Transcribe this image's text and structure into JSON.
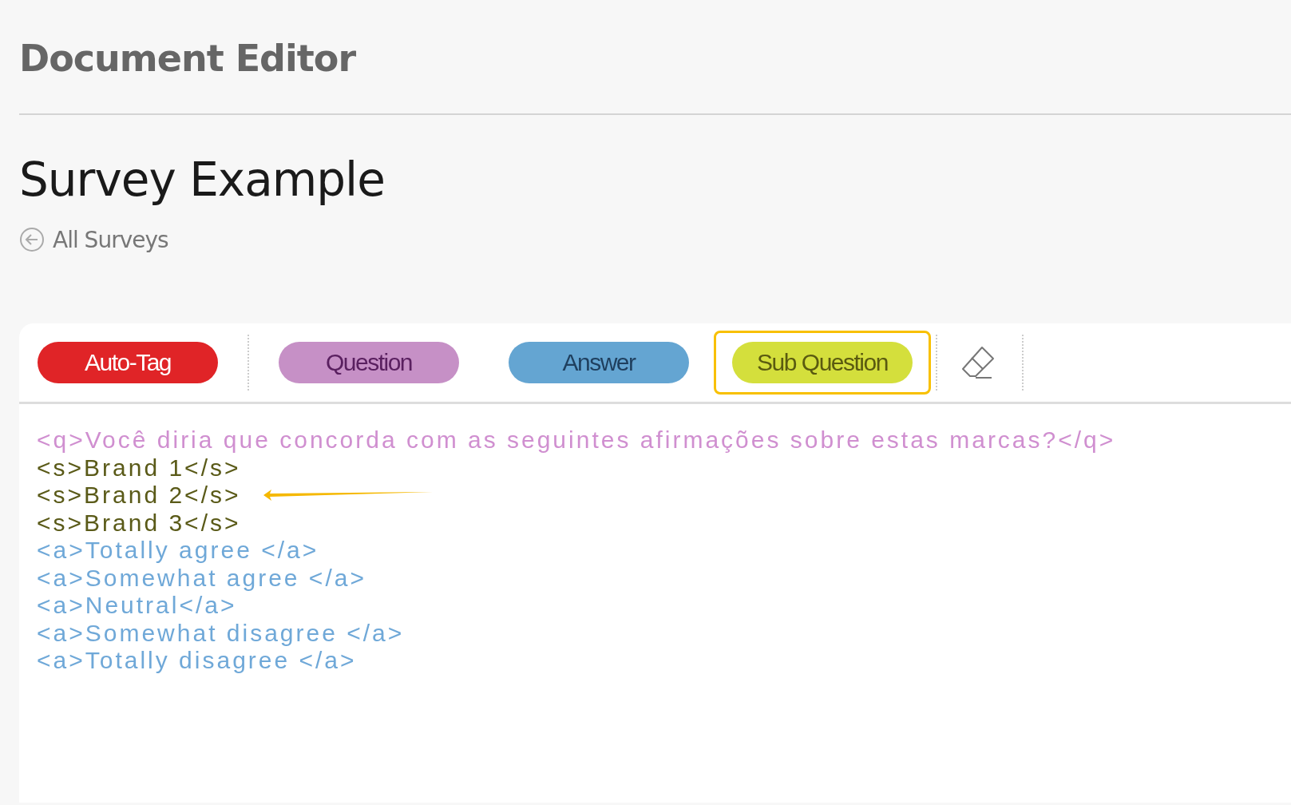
{
  "header": {
    "title": "Document Editor"
  },
  "page": {
    "title": "Survey Example",
    "back_link": "All Surveys"
  },
  "toolbar": {
    "buttons": [
      {
        "kind": "autotag",
        "label": "Auto-Tag",
        "color": "#e02427",
        "highlighted": false
      },
      {
        "kind": "question",
        "label": "Question",
        "color": "#c690c6",
        "highlighted": false
      },
      {
        "kind": "answer",
        "label": "Answer",
        "color": "#64a5d2",
        "highlighted": false
      },
      {
        "kind": "subquestion",
        "label": "Sub Question",
        "color": "#d4df3c",
        "highlighted": true
      }
    ]
  },
  "editor": {
    "lines": [
      {
        "kind": "q",
        "text": "<q>Você diria que concorda com as seguintes afirmações sobre estas marcas?</q>",
        "pointer": false
      },
      {
        "kind": "s",
        "text": "<s>Brand 1</s>",
        "pointer": false
      },
      {
        "kind": "s",
        "text": "<s>Brand 2</s>",
        "pointer": true
      },
      {
        "kind": "s",
        "text": "<s>Brand 3</s>",
        "pointer": false
      },
      {
        "kind": "a",
        "text": "<a>Totally agree </a>",
        "pointer": false
      },
      {
        "kind": "a",
        "text": "<a>Somewhat agree </a>",
        "pointer": false
      },
      {
        "kind": "a",
        "text": "<a>Neutral</a>",
        "pointer": false
      },
      {
        "kind": "a",
        "text": "<a>Somewhat disagree </a>",
        "pointer": false
      },
      {
        "kind": "a",
        "text": "<a>Totally disagree </a>",
        "pointer": false
      }
    ]
  }
}
